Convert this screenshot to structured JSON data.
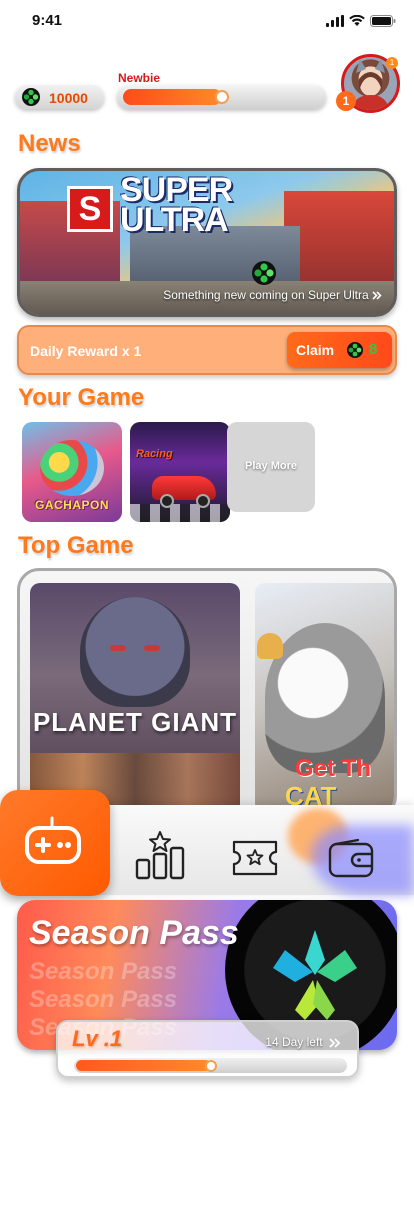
{
  "status_bar": {
    "time": "9:41",
    "icons": [
      "signal-icon",
      "wifi-icon",
      "battery-icon"
    ]
  },
  "header": {
    "coin_balance": "10000",
    "rank_label": "Newbie",
    "rank_progress": 0.5,
    "level_badge": "1",
    "avatar_badge": "1"
  },
  "sections": {
    "news_title": "News",
    "your_game_title": "Your Game",
    "top_game_title": "Top Game"
  },
  "news": {
    "banner_logo_letter": "S",
    "banner_logo_text_line1": "SUPER",
    "banner_logo_text_line2": "ULTRA",
    "caption": "Something new coming on Super Ultra",
    "caption_icon": "double-chevron-right-icon"
  },
  "daily_reward": {
    "label": "Daily Reward x 1",
    "claim_label": "Claim",
    "claim_amount": "8"
  },
  "your_games": [
    {
      "title": "GACHAPON"
    },
    {
      "title": "Racing"
    }
  ],
  "play_more_label": "Play More",
  "top_games": [
    {
      "title": "PLANET GIANT"
    },
    {
      "title_line1": "Get Th",
      "title_line2": "CAT"
    }
  ],
  "bottom_nav": {
    "items": [
      {
        "icon": "gamepad-icon",
        "active": true
      },
      {
        "icon": "leaderboard-icon",
        "active": false
      },
      {
        "icon": "ticket-star-icon",
        "active": false
      },
      {
        "icon": "wallet-icon",
        "active": false
      }
    ]
  },
  "season_pass": {
    "title": "Season Pass",
    "echo_text": "Season Pass",
    "level_label": "Lv .1",
    "days_left": "14 Day left",
    "days_icon": "double-chevron-right-icon",
    "progress": 0.5
  },
  "colors": {
    "accent_orange": "#ff7a1a",
    "rank_red": "#d31b1b",
    "coin_green": "#2ec84a"
  }
}
